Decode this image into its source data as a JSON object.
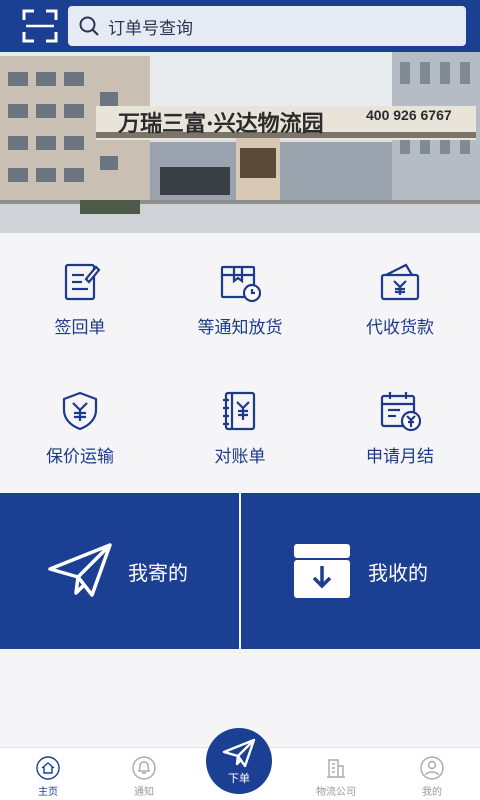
{
  "header": {
    "search_placeholder": "订单号查询"
  },
  "banner": {
    "sign_text": "万瑞三富·兴达物流园",
    "phone": "400 926 6767"
  },
  "services": [
    {
      "label": "签回单",
      "icon": "signed-receipt-icon"
    },
    {
      "label": "等通知放货",
      "icon": "wait-notify-box-icon"
    },
    {
      "label": "代收货款",
      "icon": "collect-payment-wallet-icon"
    },
    {
      "label": "保价运输",
      "icon": "insured-shield-icon"
    },
    {
      "label": "对账单",
      "icon": "statement-book-icon"
    },
    {
      "label": "申请月结",
      "icon": "monthly-settle-calendar-icon"
    }
  ],
  "tiles": {
    "sent": "我寄的",
    "received": "我收的"
  },
  "nav": [
    {
      "label": "主页"
    },
    {
      "label": "通知"
    },
    {
      "label": "下单"
    },
    {
      "label": "物流公司"
    },
    {
      "label": "我的"
    }
  ],
  "colors": {
    "brand": "#1b3f93",
    "icon_line": "#1d3a8a"
  }
}
